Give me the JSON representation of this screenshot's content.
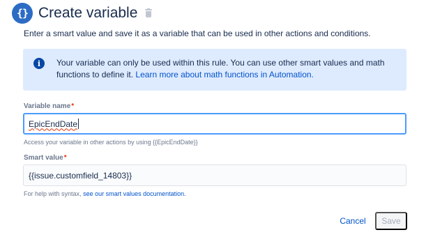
{
  "header": {
    "icon": "curly-braces-icon",
    "title": "Create variable",
    "delete_icon": "trash-icon"
  },
  "description": "Enter a smart value and save it as a variable that can be used in other actions and conditions.",
  "info_panel": {
    "icon": "info-icon",
    "text": "Your variable can only be used within this rule. You can use other smart values and math functions to define it.",
    "link_text": "Learn more about math functions in Automation."
  },
  "variable_name": {
    "label": "Variable name",
    "required_mark": "*",
    "value": "EpicEndDate",
    "helper": "Access your variable in other actions by using {{EpicEndDate}}"
  },
  "smart_value": {
    "label": "Smart value",
    "required_mark": "*",
    "value": "{{issue.customfield_14803}}",
    "helper_text": "For help with syntax,",
    "helper_link": "see our smart values documentation."
  },
  "footer": {
    "cancel_label": "Cancel",
    "save_label": "Save"
  },
  "colors": {
    "accent": "#0052cc",
    "info_background": "#deebff",
    "focus_border": "#4c9aff",
    "required": "#de350b"
  }
}
